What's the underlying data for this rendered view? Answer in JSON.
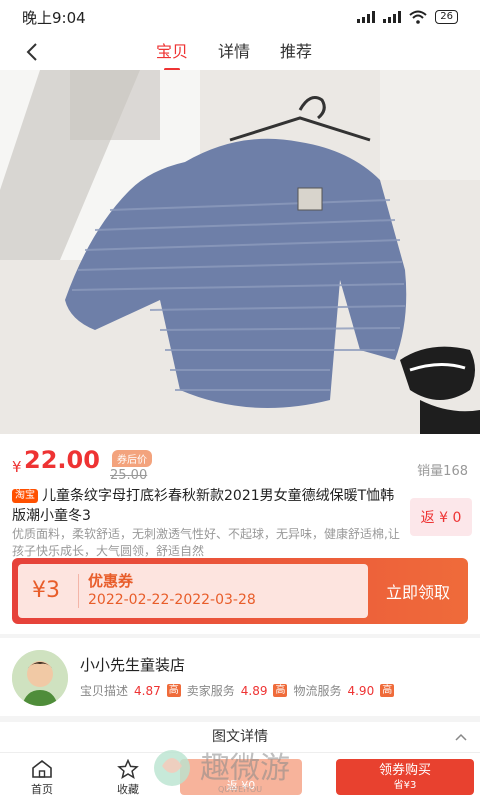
{
  "status_bar": {
    "time": "晚上9:04",
    "battery": "26"
  },
  "nav": {
    "tabs": [
      {
        "label": "宝贝"
      },
      {
        "label": "详情"
      },
      {
        "label": "推荐"
      }
    ]
  },
  "price": {
    "currency": "¥",
    "current": "22.00",
    "after_coupon_badge": "券后价",
    "original": "25.00",
    "sales": "销量168"
  },
  "product": {
    "platform_tag": "淘宝",
    "title": "儿童条纹字母打底衫春秋新款2021男女童德绒保暖T恤韩版潮小童冬3",
    "description": "优质面料，柔软舒适，无刺激透气性好、不起球，无异味，健康舒适棉,让孩子快乐成长，大气圆领，舒适自然",
    "rebate": "返 ¥ 0"
  },
  "coupon": {
    "amount": "¥3",
    "label": "优惠券",
    "dates": "2022-02-22-2022-03-28",
    "button": "立即领取"
  },
  "shop": {
    "name": "小小先生童装店",
    "scores": [
      {
        "label": "宝贝描述",
        "value": "4.87",
        "level": "高"
      },
      {
        "label": "卖家服务",
        "value": "4.89",
        "level": "高"
      },
      {
        "label": "物流服务",
        "value": "4.90",
        "level": "高"
      }
    ]
  },
  "details": {
    "title": "图文详情"
  },
  "bottom_bar": {
    "home": "首页",
    "favorite": "收藏",
    "share": "返 ¥0",
    "buy_label": "领券购买",
    "buy_save": "省¥3"
  },
  "watermark": {
    "text": "趣微游",
    "sub": "QUWEIYOU"
  },
  "colors": {
    "accent": "#e33333",
    "coupon": "#e6413a",
    "buy": "#e8412f"
  }
}
